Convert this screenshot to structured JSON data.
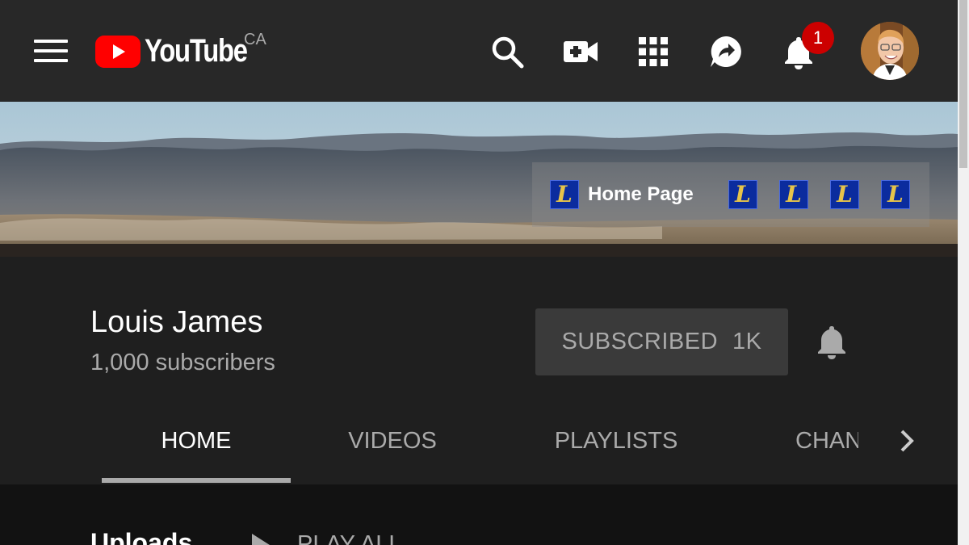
{
  "header": {
    "logo_text": "YouTube",
    "country_code": "CA",
    "notification_count": "1"
  },
  "banner": {
    "home_page_label": "Home Page",
    "favicon_glyph": "L"
  },
  "channel": {
    "name": "Louis James",
    "subscribers": "1,000 subscribers",
    "subscribe_label": "SUBSCRIBED",
    "subscribe_count": "1K"
  },
  "tabs": [
    {
      "label": "HOME",
      "active": true
    },
    {
      "label": "VIDEOS"
    },
    {
      "label": "PLAYLISTS"
    },
    {
      "label": "CHANNELS"
    }
  ],
  "content": {
    "section_title": "Uploads",
    "play_all_label": "PLAY ALL"
  },
  "colors": {
    "topbar_bg": "#282828",
    "page_bg": "#1f1f1f",
    "brand_red": "#ff0000",
    "badge_red": "#cc0000"
  },
  "icons": [
    "menu-icon",
    "search-icon",
    "create-video-icon",
    "apps-icon",
    "share-icon",
    "notifications-bell-icon",
    "chevron-right-icon",
    "play-icon"
  ]
}
